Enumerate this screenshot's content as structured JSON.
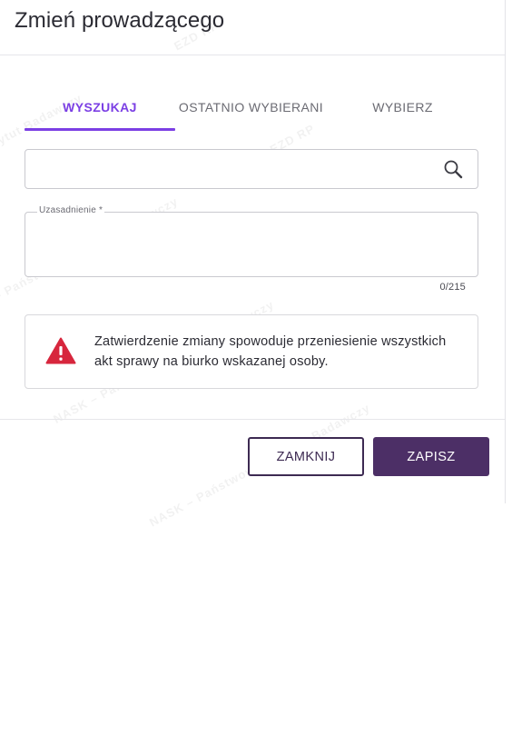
{
  "dialog": {
    "title": "Zmień prowadzącego"
  },
  "tabs": [
    {
      "label": "WYSZUKAJ",
      "active": true
    },
    {
      "label": "OSTATNIO WYBIERANI",
      "active": false
    },
    {
      "label": "WYBIERZ",
      "active": false
    }
  ],
  "search": {
    "value": "",
    "icon": "search-icon"
  },
  "reason": {
    "label": "Uzasadnienie *",
    "value": "",
    "counter": "0/215"
  },
  "alert": {
    "icon": "warning-triangle-icon",
    "text": "Zatwierdzenie zmiany spowoduje przeniesienie wszystkich akt sprawy na biurko wskazanej osoby."
  },
  "buttons": {
    "close_label": "ZAMKNIJ",
    "save_label": "ZAPISZ"
  },
  "watermark": {
    "text": "NASK – Państwowy Instytut Badawczy",
    "logo": "EZD RP"
  },
  "colors": {
    "accent": "#7b3fe4",
    "primary_button": "#4c2f66",
    "warning": "#d7263d"
  }
}
